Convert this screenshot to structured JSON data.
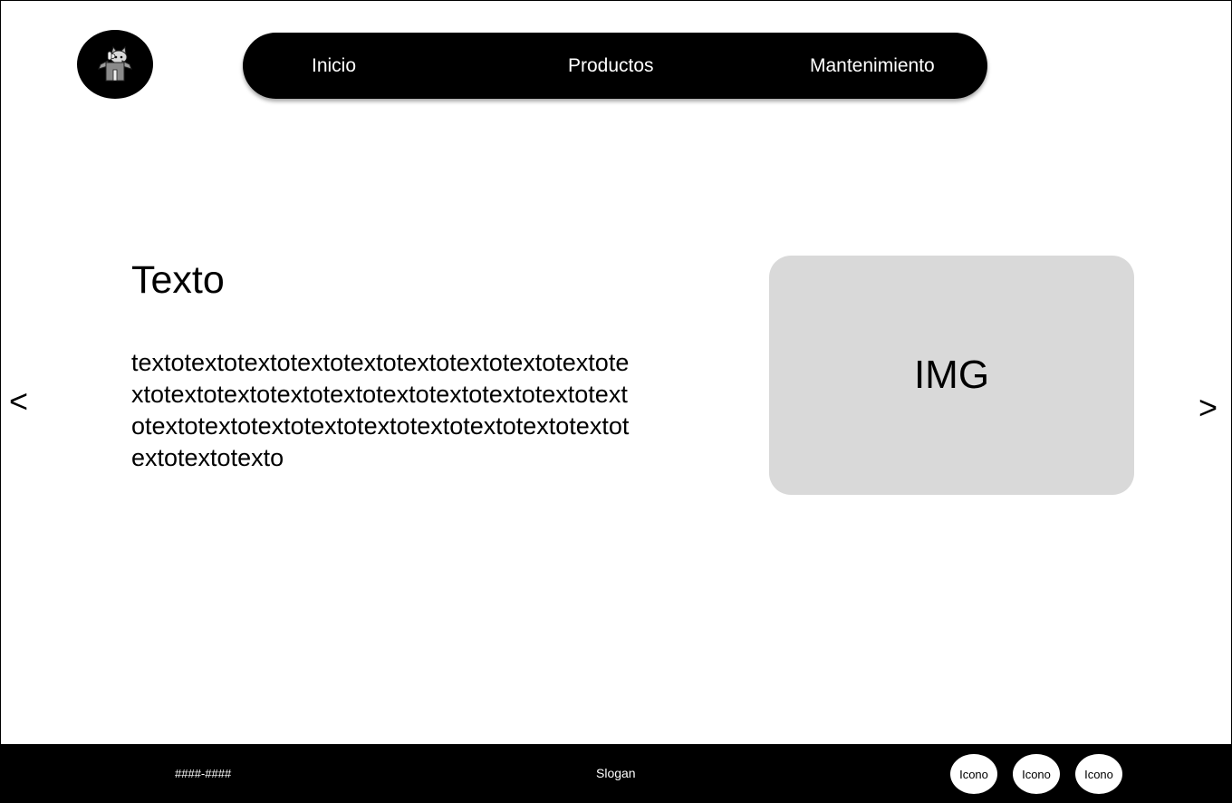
{
  "header": {
    "logo_icon": "cat-in-box-icon",
    "nav": [
      {
        "label": "Inicio"
      },
      {
        "label": "Productos"
      },
      {
        "label": "Mantenimiento"
      }
    ]
  },
  "hero": {
    "title": "Texto",
    "body": "textotextotextotextotextotextotextotextotextotextotextotextotextotextotextotextotextotextotextotextotextotextotextotextotextotextotextotextotextotextotexto",
    "image_label": "IMG",
    "prev_label": "<",
    "next_label": ">"
  },
  "footer": {
    "phone": "####-####",
    "slogan": "Slogan",
    "icons": [
      {
        "label": "Icono"
      },
      {
        "label": "Icono"
      },
      {
        "label": "Icono"
      }
    ]
  },
  "colors": {
    "background": "#ffffff",
    "nav_bg": "#000000",
    "footer_bg": "#000000",
    "placeholder_bg": "#d9d9d9",
    "text_on_dark": "#ffffff"
  }
}
